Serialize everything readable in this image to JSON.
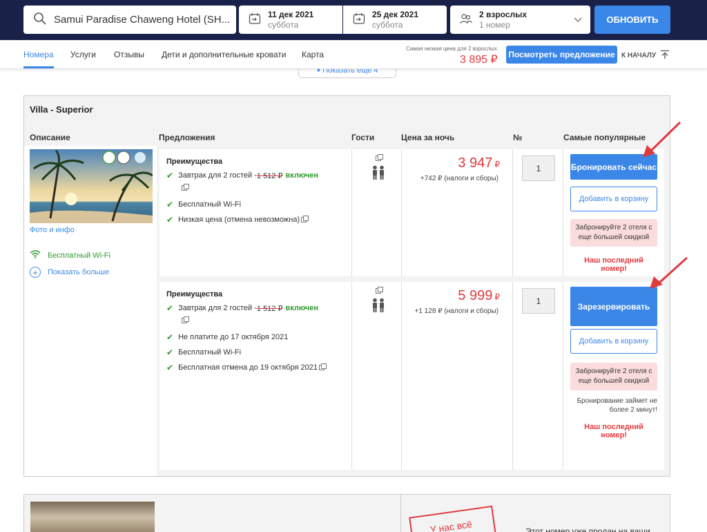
{
  "search": {
    "hotel": "Samui Paradise Chaweng Hotel (SH...",
    "checkin_date": "11 дек 2021",
    "checkin_day": "суббота",
    "checkout_date": "25 дек 2021",
    "checkout_day": "суббота",
    "guests": "2 взрослых",
    "rooms": "1 номер",
    "refresh_label": "ОБНОВИТЬ"
  },
  "nav": {
    "tabs": [
      "Номера",
      "Услуги",
      "Отзывы",
      "Дети и дополнительные кровати",
      "Карта"
    ],
    "lowest_label": "Самая низкая цена для 2 взрослых",
    "lowest_price": "3 895 ₽",
    "offer_button": "Посмотреть предложение",
    "to_top": "К НАЧАЛУ"
  },
  "show_more_pill": "▾ Показать еще 4",
  "room": {
    "title": "Villa - Superior",
    "col_description": "Описание",
    "col_offers": "Предложения",
    "col_guests": "Гости",
    "col_price": "Цена за ночь",
    "col_num": "№",
    "col_popular": "Самые популярные",
    "photo_link": "Фото и инфо",
    "wifi": "Бесплатный Wi-Fi",
    "show_more": "Показать больше"
  },
  "offers": [
    {
      "adv_title": "Преимущества",
      "breakfast_prefix": "Завтрак для 2 гостей - ",
      "breakfast_old": "1 512 ₽",
      "breakfast_included": "включен",
      "items": [
        "Бесплатный Wi-Fi",
        "Низкая цена (отмена невозможна)"
      ],
      "price": "3 947",
      "currency": "₽",
      "tax": "+742 ₽ (налоги и сборы)",
      "qty": "1",
      "book_label": "Бронировать сейчас",
      "cart_label": "Добавить в корзину",
      "promo": "Забронируйте 2 отеля с еще большей скидкой",
      "last_room": "Наш последний номер!"
    },
    {
      "adv_title": "Преимущества",
      "breakfast_prefix": "Завтрак для 2 гостей - ",
      "breakfast_old": "1 512 ₽",
      "breakfast_included": "включен",
      "items": [
        "Не платите до 17 октября 2021",
        "Бесплатный Wi-Fi",
        "Бесплатная отмена до 19 октября 2021"
      ],
      "price": "5 999",
      "currency": "₽",
      "tax": "+1 128 ₽ (налоги и сборы)",
      "qty": "1",
      "book_label": "Зарезервировать",
      "cart_label": "Добавить в корзину",
      "promo": "Забронируйте 2 отеля с еще большей скидкой",
      "note": "Бронирование займет не более 2 минут!",
      "last_room": "Наш последний номер!"
    }
  ],
  "room2": {
    "stamp": "У нас всё",
    "sold_text": "Этот номер уже продан на ваши"
  },
  "colors": {
    "header_bg": "#1a2149",
    "accent": "#3b87e8",
    "price_red": "#e0393e",
    "green": "#2e9a2e"
  }
}
